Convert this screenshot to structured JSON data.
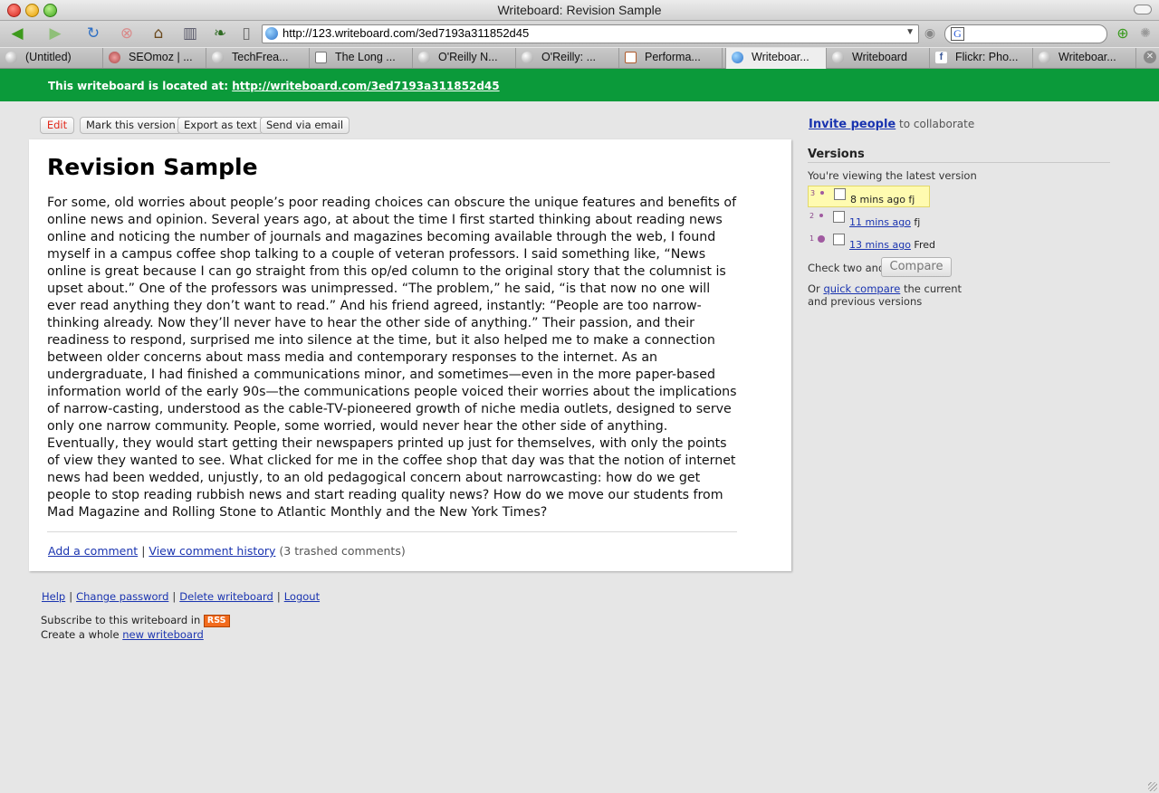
{
  "window": {
    "title": "Writeboard: Revision Sample"
  },
  "toolbar": {
    "url": "http://123.writeboard.com/3ed7193a311852d45",
    "icons": [
      "back-icon",
      "forward-icon",
      "reload-icon",
      "stop-icon",
      "home-icon",
      "bookmarks-icon",
      "leaf-icon",
      "page-icon"
    ]
  },
  "tabs": [
    {
      "label": "(Untitled)",
      "favicon": "globe-icon"
    },
    {
      "label": "SEOmoz | ...",
      "favicon": "gear-icon"
    },
    {
      "label": "TechFrea...",
      "favicon": "globe-icon"
    },
    {
      "label": "The Long ...",
      "favicon": "page-icon"
    },
    {
      "label": "O'Reilly N...",
      "favicon": "globe-icon"
    },
    {
      "label": "O'Reilly: ...",
      "favicon": "globe-icon"
    },
    {
      "label": "Performa...",
      "favicon": "page-icon"
    },
    {
      "label": "Writeboar...",
      "favicon": "globe-icon",
      "active": true
    },
    {
      "label": "Writeboard",
      "favicon": "globe-icon"
    },
    {
      "label": "Flickr: Pho...",
      "favicon": "facebook-icon"
    },
    {
      "label": "Writeboar...",
      "favicon": "globe-icon"
    }
  ],
  "banner": {
    "prefix": "This writeboard is located at:",
    "link": "http://writeboard.com/3ed7193a311852d45"
  },
  "actions": {
    "edit": "Edit",
    "mark": "Mark this version",
    "export": "Export as text",
    "email": "Send via email"
  },
  "document": {
    "title": "Revision Sample",
    "body": "For some, old worries about people’s poor reading choices can obscure the unique features and benefits of online news and opinion. Several years ago, at about the time I first started thinking about reading news online and noticing the number of journals and magazines becoming available through the web, I found myself in a campus coffee shop talking to a couple of veteran professors. I said something like, “News online is great because I can go straight from this op/ed column to the original story that the columnist is upset about.” One of the professors was unimpressed. “The problem,” he said, “is that now no one will ever read anything they don’t want to read.” And his friend agreed, instantly: “People are too narrow-thinking already. Now they’ll never have to hear the other side of anything.” Their passion, and their readiness to respond, surprised me into silence at the time, but it also helped me to make a connection between older concerns about mass media and contemporary responses to the internet. As an undergraduate, I had finished a communications minor, and sometimes—even in the more paper-based information world of the early 90s—the communications people voiced their worries about the implications of narrow-casting, understood as the cable-TV-pioneered growth of niche media outlets, designed to serve only one narrow community. People, some worried, would never hear the other side of anything. Eventually, they would start getting their newspapers printed up just for themselves, with only the points of view they wanted to see. What clicked for me in the coffee shop that day was that the notion of internet news had been wedded, unjustly, to an old pedagogical concern about narrowcasting: how do we get people to stop reading rubbish news and start reading quality news? How do we move our students from Mad Magazine and Rolling Stone to Atlantic Monthly and the New York Times?"
  },
  "comments": {
    "add": "Add a comment",
    "history": "View comment history",
    "trashed": "(3 trashed comments)",
    "separator": "|"
  },
  "footer": {
    "links": [
      "Help",
      "Change password",
      "Delete writeboard",
      "Logout"
    ],
    "subscribe": "Subscribe to this writeboard in",
    "rss": "RSS",
    "create_prefix": "Create a whole",
    "create_link": "new writeboard"
  },
  "sidebar": {
    "invite_link": "Invite people",
    "invite_suffix": "to collaborate",
    "versions_heading": "Versions",
    "viewing": "You're viewing the latest version",
    "versions": [
      {
        "number": "3",
        "time": "8 mins ago",
        "author": "fj",
        "current": true
      },
      {
        "number": "2",
        "time": "11 mins ago",
        "author": "fj",
        "current": false
      },
      {
        "number": "1",
        "time": "13 mins ago",
        "author": "Fred",
        "current": false
      }
    ],
    "check_two": "Check two and",
    "compare": "Compare",
    "or": "Or",
    "quick_compare": "quick compare",
    "quick_suffix_1": "the current",
    "quick_suffix_2": "and previous versions"
  }
}
